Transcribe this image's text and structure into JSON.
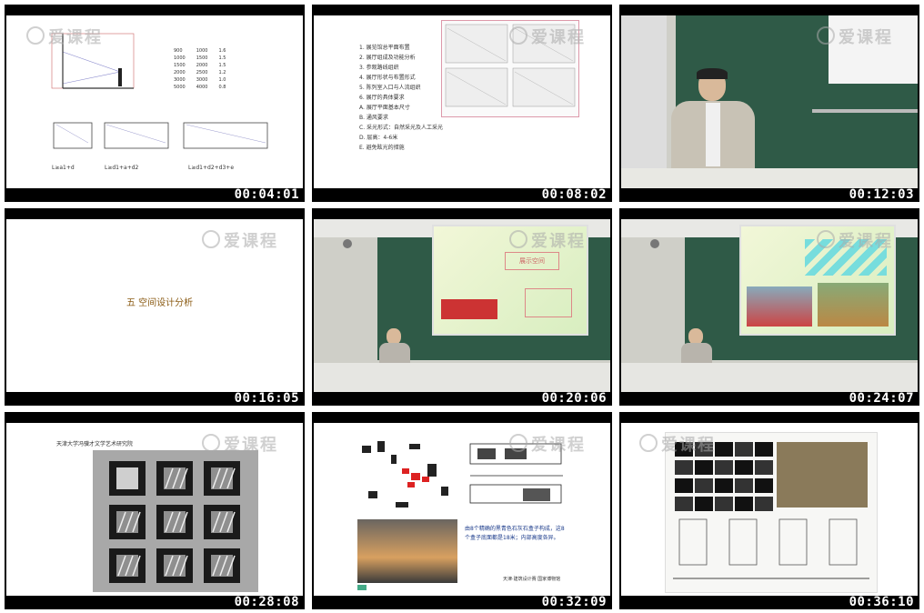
{
  "watermark": "爱课程",
  "tiles": [
    {
      "timestamp": "00:04:01",
      "labels": [
        "L≥a1+d",
        "L≥d1+a+d2",
        "L≥d1+d2+d3+e"
      ]
    },
    {
      "timestamp": "00:08:02",
      "items": [
        "1. 展览馆总平面布置",
        "2. 展厅组成及功能分析",
        "3. 参观路线组织",
        "4. 展厅形状与布置形式",
        "5. 陈列室入口与人流组织",
        "6. 展厅的具体要求",
        "A. 展厅平面基本尺寸",
        "B. 通风要求",
        "C. 采光形式：自然采光及人工采光",
        "D. 层高：4-6米",
        "E. 避免眩光的措施"
      ]
    },
    {
      "timestamp": "00:12:03"
    },
    {
      "timestamp": "00:16:05",
      "heading": "五  空间设计分析"
    },
    {
      "timestamp": "00:20:06",
      "slide_text": "展示空间"
    },
    {
      "timestamp": "00:24:07"
    },
    {
      "timestamp": "00:28:08",
      "caption": "天津大学冯骥才文学艺术研究院"
    },
    {
      "timestamp": "00:32:09",
      "caption": "由8个精确的黑青色石灰石盒子构成，这8个盒子底面都是18米；内部高度各异。",
      "footer": "天津·建筑设计赛  国家博物馆"
    },
    {
      "timestamp": "00:36:10"
    }
  ],
  "table_rows": [
    [
      "900",
      "1000",
      "1.6"
    ],
    [
      "1000",
      "1500",
      "1.5"
    ],
    [
      "1500",
      "2000",
      "1.5"
    ],
    [
      "2000",
      "2500",
      "1.2"
    ],
    [
      "3000",
      "3000",
      "1.0"
    ],
    [
      "5000",
      "4000",
      "0.8"
    ]
  ]
}
